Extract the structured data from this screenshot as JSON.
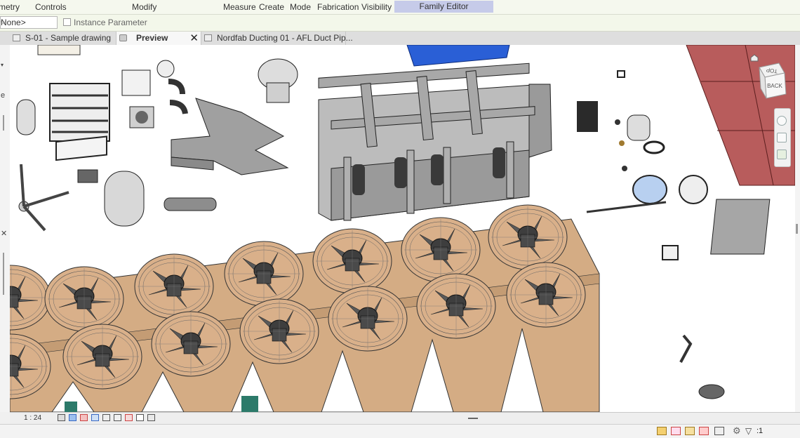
{
  "ribbon": {
    "tabs": [
      "metry",
      "Controls",
      "Modify",
      "Measure",
      "Create",
      "Mode",
      "Fabrication",
      "Visibility"
    ],
    "context_tab": "Family Editor"
  },
  "options_bar": {
    "selector_value": "None>",
    "instance_parameter_label": "Instance Parameter"
  },
  "view_tabs": [
    {
      "label": "S-01 - Sample drawing",
      "active": false
    },
    {
      "label": "Preview",
      "active": true
    },
    {
      "label": "Nordfab Ducting 01 - AFL Duct Pip...",
      "active": false
    }
  ],
  "navigation_cube": {
    "top_label": "TOP",
    "front_label": "BACK"
  },
  "status": {
    "scale": "1 : 24",
    "filter_count": ":1"
  },
  "colors": {
    "ribbon_bg": "#f5f8ee",
    "context_tab": "#c6cbe9",
    "roof_red": "#b85c5c",
    "chiller_tan": "#d4ac84",
    "fan_gray": "#6a6a6a",
    "rack_gray": "#a8a8a8",
    "tank_blue": "#2a5fd6"
  }
}
